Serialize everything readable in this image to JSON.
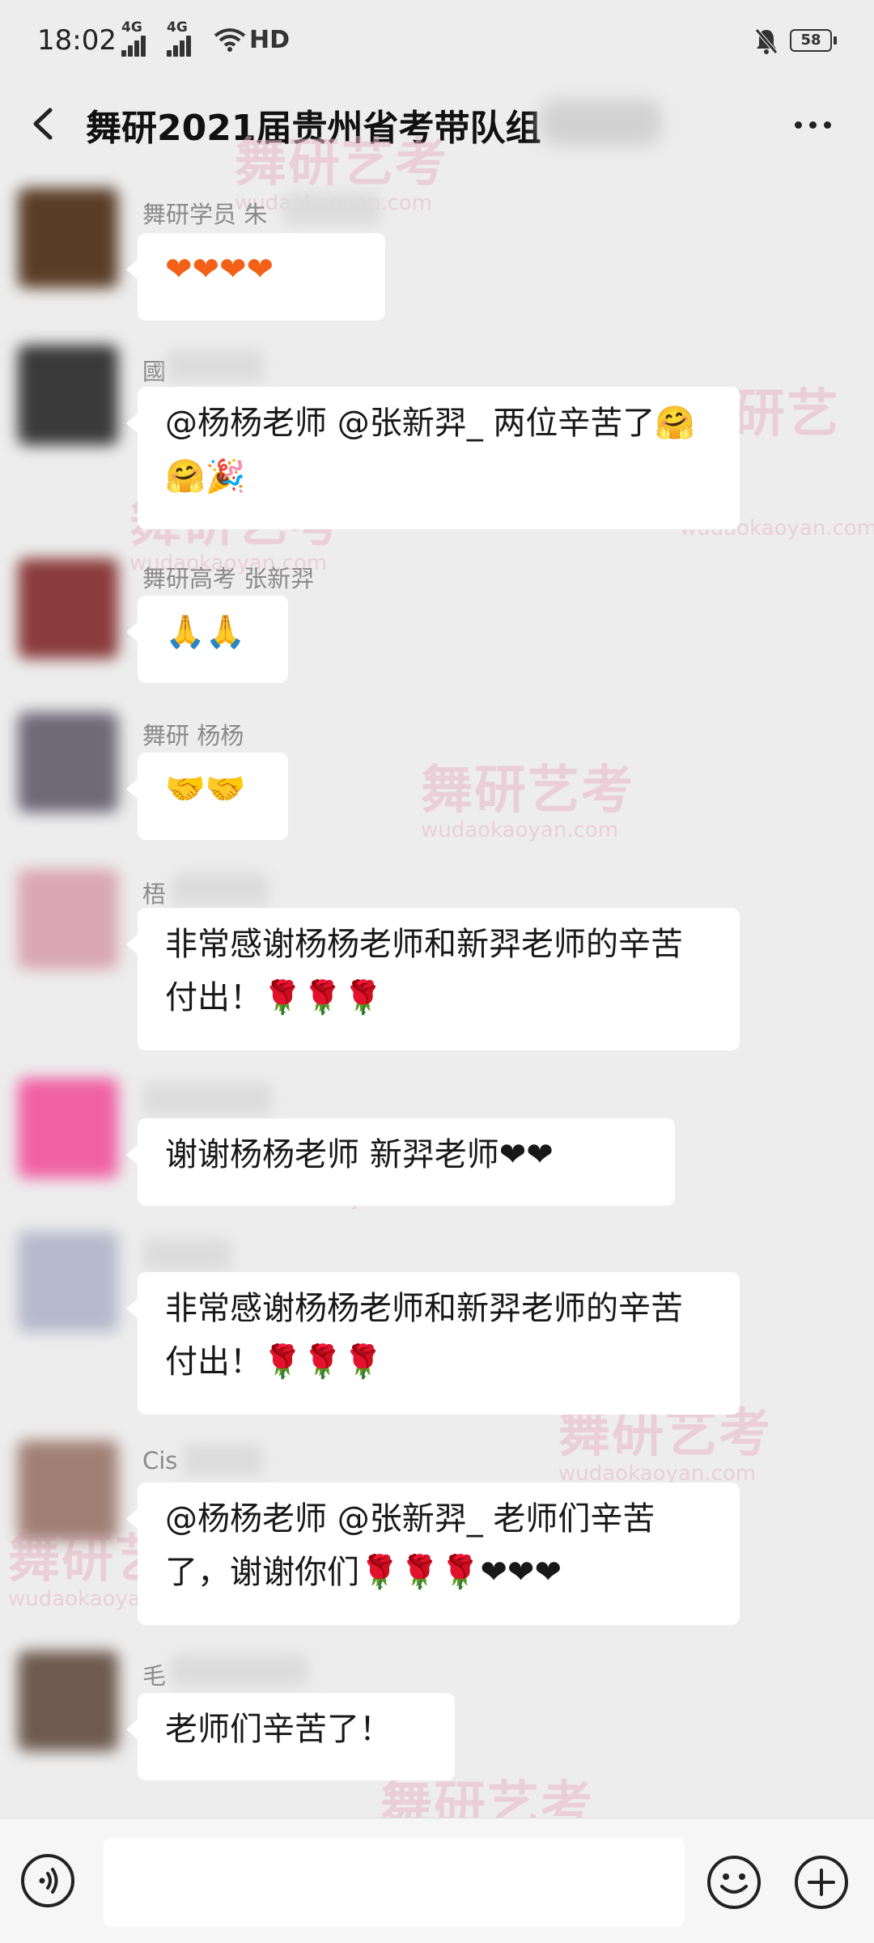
{
  "status_bar": {
    "time": "18:02",
    "signal_1": "4G",
    "signal_2": "4G",
    "hd": "HD",
    "battery": "58"
  },
  "header": {
    "title": "舞研2021届贵州省考带队组"
  },
  "messages": [
    {
      "sender": "舞研学员 朱",
      "text": "❤❤❤❤",
      "avatar_color": "#5a3d26"
    },
    {
      "sender": "國",
      "text": "@杨杨老师 @张新羿_ 两位辛苦了🤗🤗🎉",
      "avatar_color": "#3a3a3a"
    },
    {
      "sender": "舞研高考 张新羿",
      "text": "🙏🙏",
      "avatar_color": "#8a3b3b"
    },
    {
      "sender": "舞研 杨杨",
      "text": "🤝🤝",
      "avatar_color": "#6e6a78"
    },
    {
      "sender": "梧",
      "text": "非常感谢杨杨老师和新羿老师的辛苦付出！🌹🌹🌹",
      "avatar_color": "#d9a6b3"
    },
    {
      "sender": "",
      "text": "谢谢杨杨老师 新羿老师❤❤",
      "avatar_color": "#f062a4"
    },
    {
      "sender": "",
      "text": "非常感谢杨杨老师和新羿老师的辛苦付出！🌹🌹🌹",
      "avatar_color": "#b6b9cc"
    },
    {
      "sender": "Cis",
      "text": "@杨杨老师 @张新羿_ 老师们辛苦了，谢谢你们🌹🌹🌹❤❤❤",
      "avatar_color": "#a17f74"
    },
    {
      "sender": "毛",
      "text": "老师们辛苦了！",
      "avatar_color": "#6e5a4e"
    }
  ],
  "watermark": {
    "cn": "舞研艺考",
    "en": "wudaokaoyan.com"
  },
  "colors": {
    "background": "#ededed",
    "bubble": "#ffffff",
    "heart": "#f36018",
    "sender": "#8a8a8a"
  }
}
